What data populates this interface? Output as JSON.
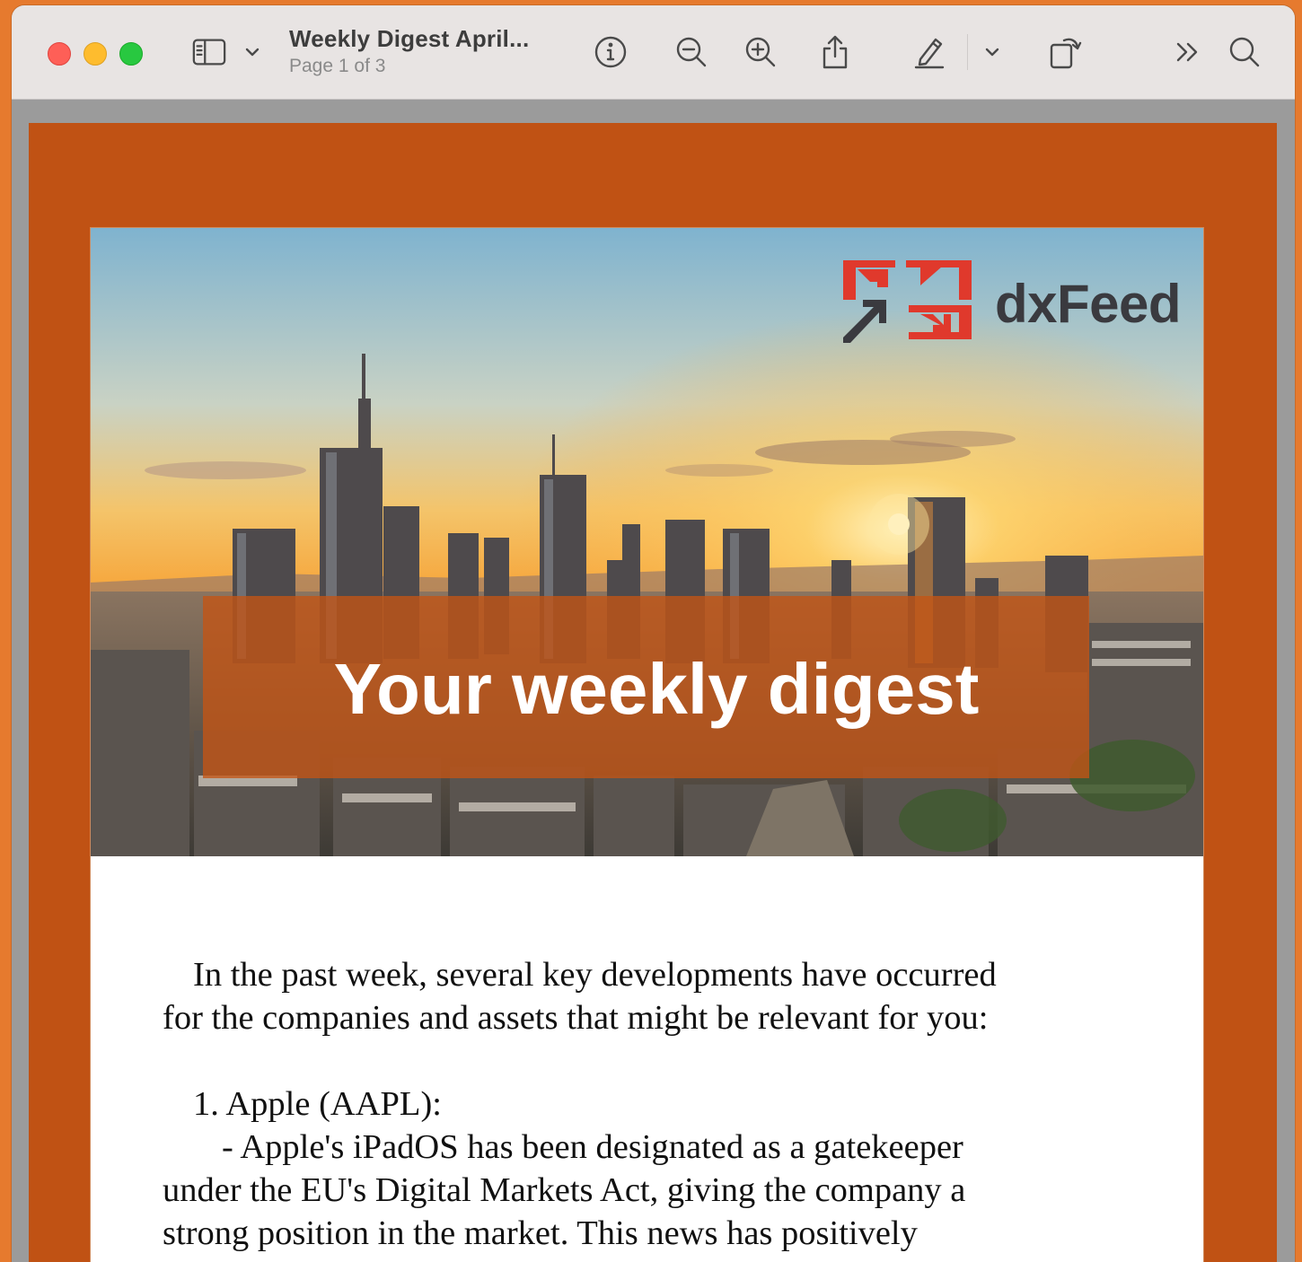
{
  "window": {
    "title": "Weekly Digest April...",
    "subtitle": "Page 1 of 3"
  },
  "toolbar": {
    "icons": [
      "sidebar-icon",
      "chevron-down-icon",
      "info-icon",
      "zoom-out-icon",
      "zoom-in-icon",
      "share-icon",
      "markup-pencil-icon",
      "chevron-down-icon",
      "rotate-icon",
      "more-chevrons-icon",
      "search-icon"
    ]
  },
  "email": {
    "brand_name": "dxFeed",
    "hero_title": "Your weekly digest",
    "intro_line1": "In the past week, several key developments have occurred",
    "intro_line2": "for the companies and assets that might be relevant for you:",
    "item1_heading": "1. Apple (AAPL):",
    "item1_line1": "- Apple's iPadOS has been designated as a gatekeeper",
    "item1_line2": "under the EU's Digital Markets Act, giving the company a",
    "item1_line3": "strong position in the market. This news has positively"
  },
  "colors": {
    "page_background": "#c05214",
    "accent_orange": "#e67a2e",
    "brand_red": "#e0392c",
    "brand_dark": "#3a3a3f"
  }
}
